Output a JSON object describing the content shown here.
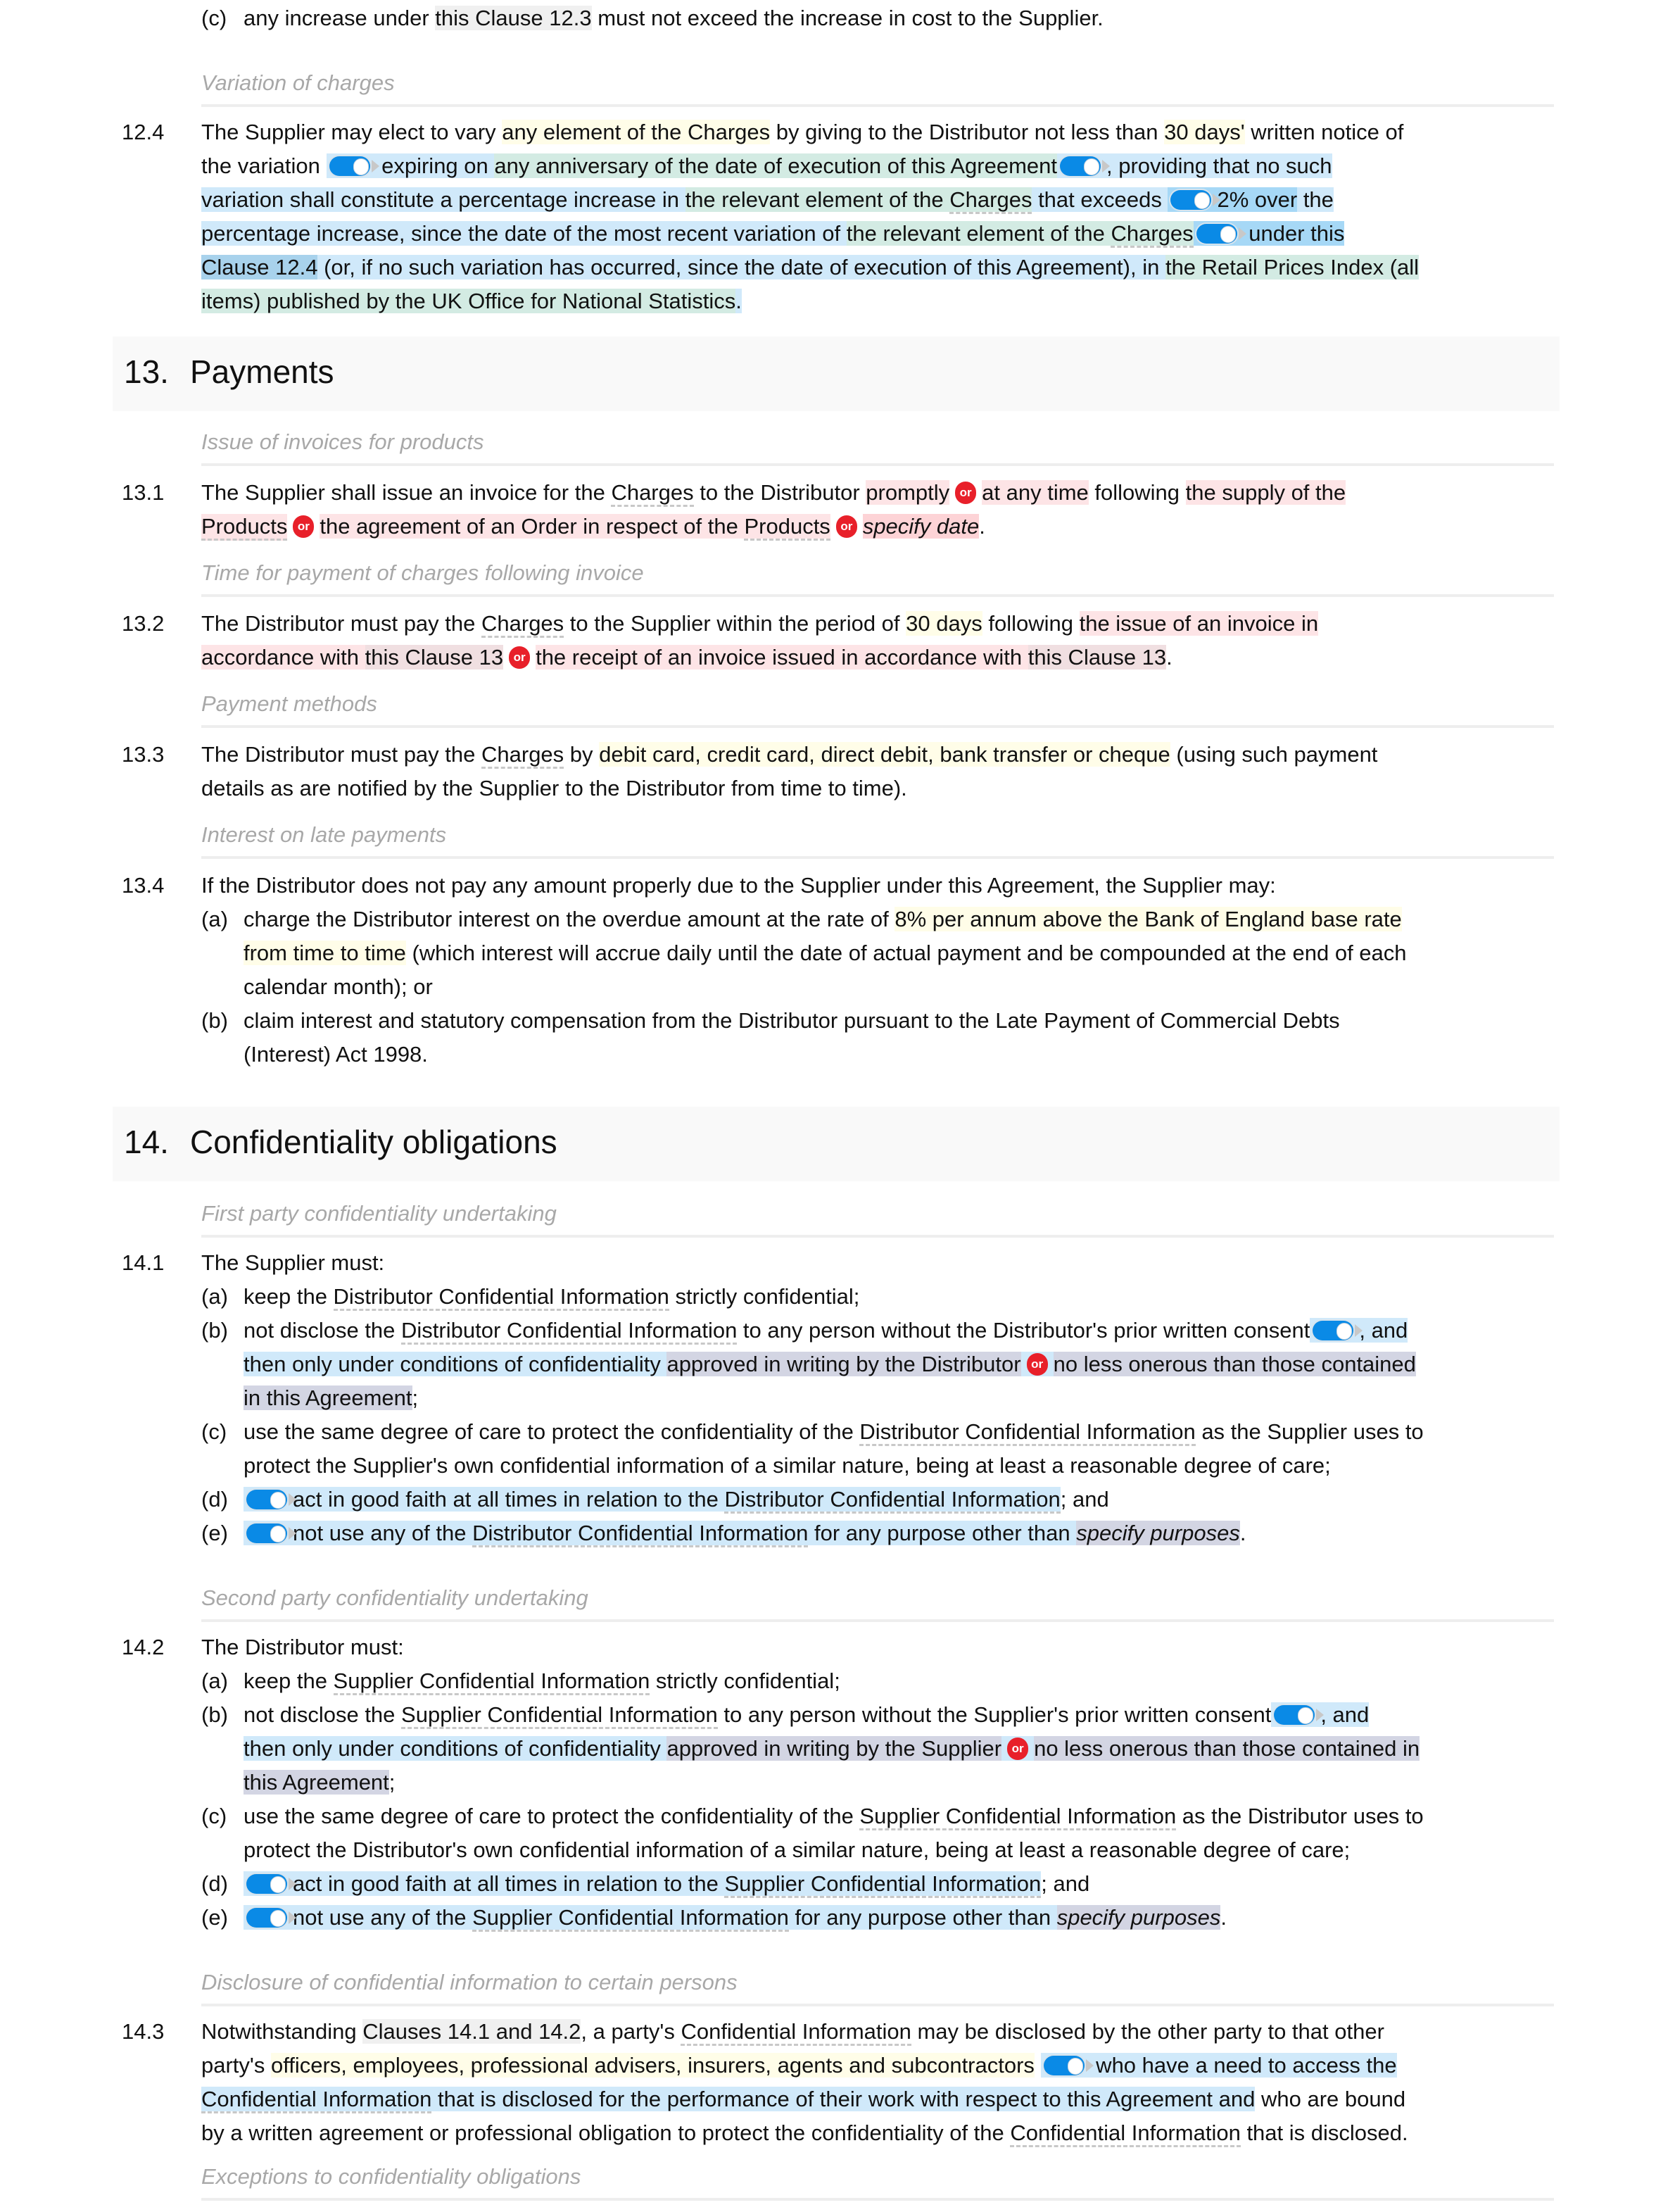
{
  "prev": {
    "c_label": "(c)",
    "c_text_1": "any increase under ",
    "c_ref": "this Clause 12.3",
    "c_text_2": " must not exceed the increase in cost to the Supplier."
  },
  "clause_12_4": {
    "caption": "Variation of charges",
    "number": "12.4",
    "t1": "The Supplier may elect to vary ",
    "y1": "any element of the Charges",
    "t2": " by giving to the Distributor not less than ",
    "y2": "30 days'",
    "t3": " written notice of",
    "t4": "the variation ",
    "b1": " expiring on ",
    "g1": "any anniversary of the date of execution of this Agreement",
    "b2": ", providing that no such",
    "b3": "variation shall constitute a percentage increase in ",
    "g2a": "the relevant element of the ",
    "g2b": "Charges",
    "b4": " that exceeds ",
    "bb1": "2% over",
    "b5": " the",
    "b6": "percentage increase, since the date of the most recent variation of ",
    "g3a": "the relevant element of the ",
    "g3b": "Charges",
    "bb2": " under this",
    "bd1": "Clause 12.4",
    "b7": " (or, if no such variation has occurred, since the date of execution of this Agreement), in ",
    "g4": "the Retail Prices Index (all",
    "g5": "items) published by the UK Office for National Statistics",
    "end": "."
  },
  "section_13": {
    "number": "13.",
    "title": "Payments",
    "c1": {
      "caption": "Issue of invoices for products",
      "number": "13.1",
      "t1": "The Supplier shall issue an invoice for the ",
      "d1": "Charges",
      "t2": " to the Distributor ",
      "p1": "promptly",
      "p2": "at any time",
      "t3": " following ",
      "p3": "the supply of the",
      "p4": "Products",
      "p5a": "the agreement of an Order in respect of the ",
      "p5b": "Products",
      "p6": "specify date",
      "end": ".",
      "or_label": "or"
    },
    "c2": {
      "caption": "Time for payment of charges following invoice",
      "number": "13.2",
      "t1": "The Distributor must pay the ",
      "d1": "Charges",
      "t2": " to the Supplier within the period of ",
      "y1": "30 days",
      "t3": " following ",
      "p1": "the issue of an invoice in",
      "p2a": "accordance with ",
      "p2b": "this Clause 13",
      "p3a": "the receipt of an invoice issued in accordance with ",
      "p3b": "this Clause 13",
      "end": ".",
      "or_label": "or"
    },
    "c3": {
      "caption": "Payment methods",
      "number": "13.3",
      "t1": "The Distributor must pay the ",
      "d1": "Charges",
      "t2": " by ",
      "y1": "debit card, credit card, direct debit, bank transfer or cheque",
      "t3": " (using such payment",
      "t4": "details as are notified by the Supplier to the Distributor from time to time)."
    },
    "c4": {
      "caption": "Interest on late payments",
      "number": "13.4",
      "t1": "If the Distributor does not pay any amount properly due to the Supplier under this Agreement, the Supplier may:",
      "a_label": "(a)",
      "a1": "charge the Distributor interest on the overdue amount at the rate of ",
      "a_y1": "8% per annum above the Bank of England base rate",
      "a_y2": "from time to time",
      "a2": " (which interest will accrue daily until the date of actual payment and be compounded at the end of each",
      "a3": "calendar month); or",
      "b_label": "(b)",
      "b1": "claim interest and statutory compensation from the Distributor pursuant to the Late Payment of Commercial Debts",
      "b2": "(Interest) Act 1998."
    }
  },
  "section_14": {
    "number": "14.",
    "title": "Confidentiality obligations",
    "c1": {
      "caption": "First party confidentiality undertaking",
      "number": "14.1",
      "intro": "The Supplier must:",
      "a_label": "(a)",
      "a1": "keep the ",
      "a_d": "Distributor Confidential Information",
      "a2": " strictly confidential;",
      "b_label": "(b)",
      "b1": "not disclose the ",
      "b_d": "Distributor Confidential Information",
      "b2": " to any person without the Distributor's prior written consent",
      "b3": ", and",
      "b4": "then only under conditions of confidentiality ",
      "b5": "approved in writing by the Distributor",
      "b6": "no less onerous than those contained",
      "b7": "in this Agreement",
      "b8": ";",
      "c_label": "(c)",
      "c1": "use the same degree of care to protect the confidentiality of the ",
      "c_d": "Distributor Confidential Information",
      "c2": " as the Supplier uses to",
      "c3": "protect the Supplier's own confidential information of a similar nature, being at least a reasonable degree of care;",
      "d_label": "(d)",
      "d1": "act in good faith at all times in relation to the ",
      "d_d": "Distributor Confidential Information",
      "d2": "; and",
      "e_label": "(e)",
      "e1": "not use any of the ",
      "e_d": "Distributor Confidential Information",
      "e2": " for any purpose other than ",
      "e3": "specify purposes",
      "e4": ".",
      "or_label": "or"
    },
    "c2": {
      "caption": "Second party confidentiality undertaking",
      "number": "14.2",
      "intro": "The Distributor must:",
      "a_label": "(a)",
      "a1": "keep the ",
      "a_d": "Supplier Confidential Information",
      "a2": " strictly confidential;",
      "b_label": "(b)",
      "b1": "not disclose the ",
      "b_d": "Supplier Confidential Information",
      "b2": " to any person without the Supplier's prior written consent",
      "b3": ", and",
      "b4": "then only under conditions of confidentiality ",
      "b5": "approved in writing by the Supplier",
      "b6": "no less onerous than those contained in",
      "b7": "this Agreement",
      "b8": ";",
      "c_label": "(c)",
      "c1": "use the same degree of care to protect the confidentiality of the ",
      "c_d": "Supplier Confidential Information",
      "c2": " as the Distributor uses to",
      "c3": "protect the Distributor's own confidential information of a similar nature, being at least a reasonable degree of care;",
      "d_label": "(d)",
      "d1": "act in good faith at all times in relation to the ",
      "d_d": "Supplier Confidential Information",
      "d2": "; and",
      "e_label": "(e)",
      "e1": "not use any of the ",
      "e_d": "Supplier Confidential Information",
      "e2": " for any purpose other than ",
      "e3": "specify purposes",
      "e4": ".",
      "or_label": "or"
    },
    "c3": {
      "caption": "Disclosure of confidential information to certain persons",
      "number": "14.3",
      "t1": "Notwithstanding ",
      "r1": "Clauses 14.1 and 14.2",
      "t2": ", a party's ",
      "d1": "Confidential Information",
      "t3": " may be disclosed by the other party to that other",
      "t4": "party's ",
      "y1": "officers, employees, professional advisers, insurers, agents and subcontractors",
      "b1": " who have a need to access the",
      "b2d": "Confidential Information",
      "b2": " that is disclosed for the performance of their work with respect to this Agreement and",
      "t5": " who are bound",
      "t6": "by a written agreement or professional obligation to protect the confidentiality of the ",
      "d2": "Confidential Information",
      "t7": " that is disclosed."
    },
    "c4": {
      "caption": "Exceptions to confidentiality obligations"
    }
  },
  "colors": {
    "toggle_on": "#0a8ae6",
    "or_badge": "#e8202a",
    "highlight_yellow": "#fffde8",
    "highlight_blue": "#d0e9fa",
    "highlight_green": "#d3ebe3",
    "highlight_pink": "#fde4e6",
    "highlight_lavender": "#d3d5e3"
  }
}
